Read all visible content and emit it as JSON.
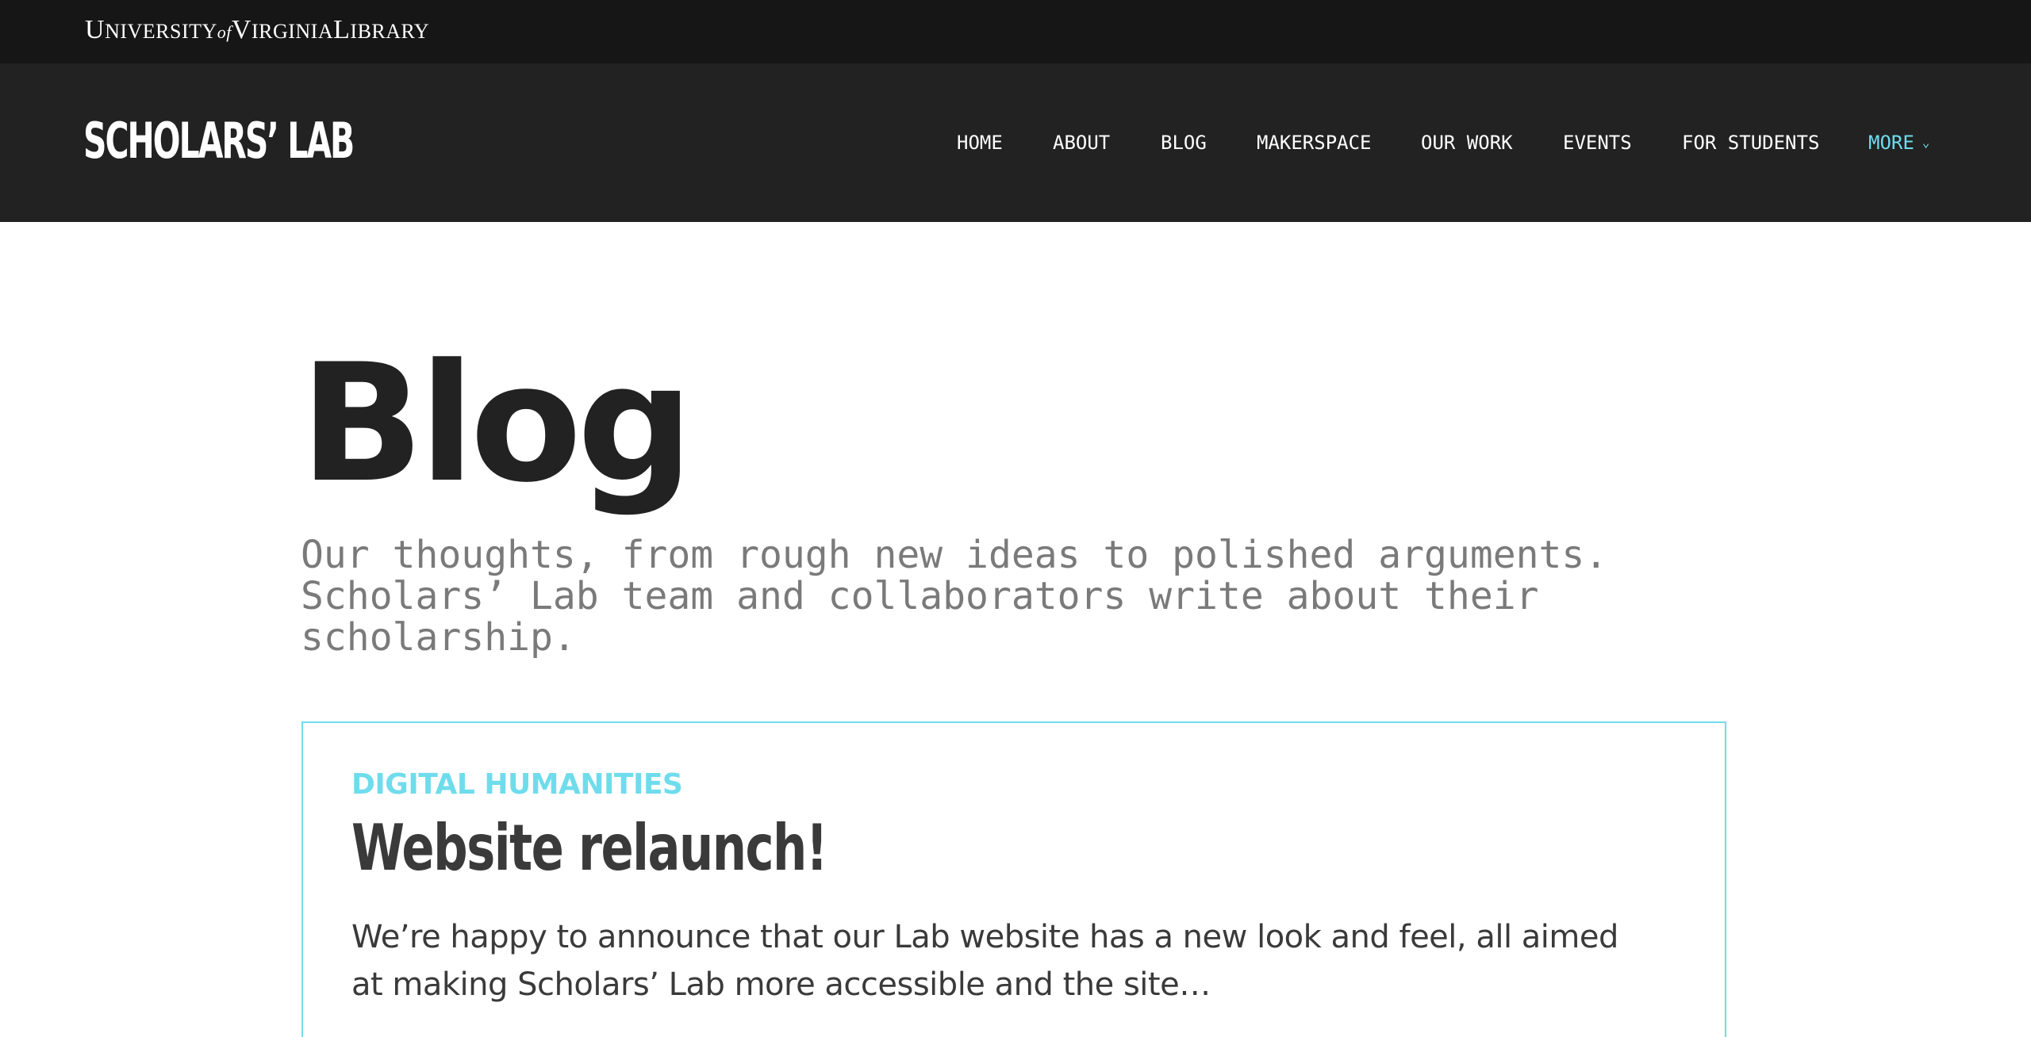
{
  "uva_bar": {
    "logo": {
      "u": "U",
      "niversity": "NIVERSITY",
      "of": "of",
      "v": "V",
      "irginia": "IRGINIA",
      "l": "L",
      "ibrary": "IBRARY"
    }
  },
  "header": {
    "site_title": "SCHOLARS’ LAB",
    "nav": [
      {
        "label": "HOME"
      },
      {
        "label": "ABOUT"
      },
      {
        "label": "BLOG"
      },
      {
        "label": "MAKERSPACE"
      },
      {
        "label": "OUR WORK"
      },
      {
        "label": "EVENTS"
      },
      {
        "label": "FOR STUDENTS"
      },
      {
        "label": "MORE",
        "icon": "chevron-down-icon"
      }
    ]
  },
  "main": {
    "title": "Blog",
    "intro": "Our thoughts, from rough new ideas to polished arguments. Scholars’ Lab team and collaborators write about their scholarship.",
    "posts": [
      {
        "category": "DIGITAL HUMANITIES",
        "title": "Website relaunch!",
        "excerpt": "We’re happy to announce that our Lab website has a new look and feel, all aimed at making Scholars’ Lab more accessible and the site…"
      }
    ]
  },
  "colors": {
    "accent": "#6fdcec",
    "header_bg": "#222222",
    "topbar_bg": "#161616",
    "text_dark": "#222222",
    "text_muted": "#7a7a7a"
  }
}
